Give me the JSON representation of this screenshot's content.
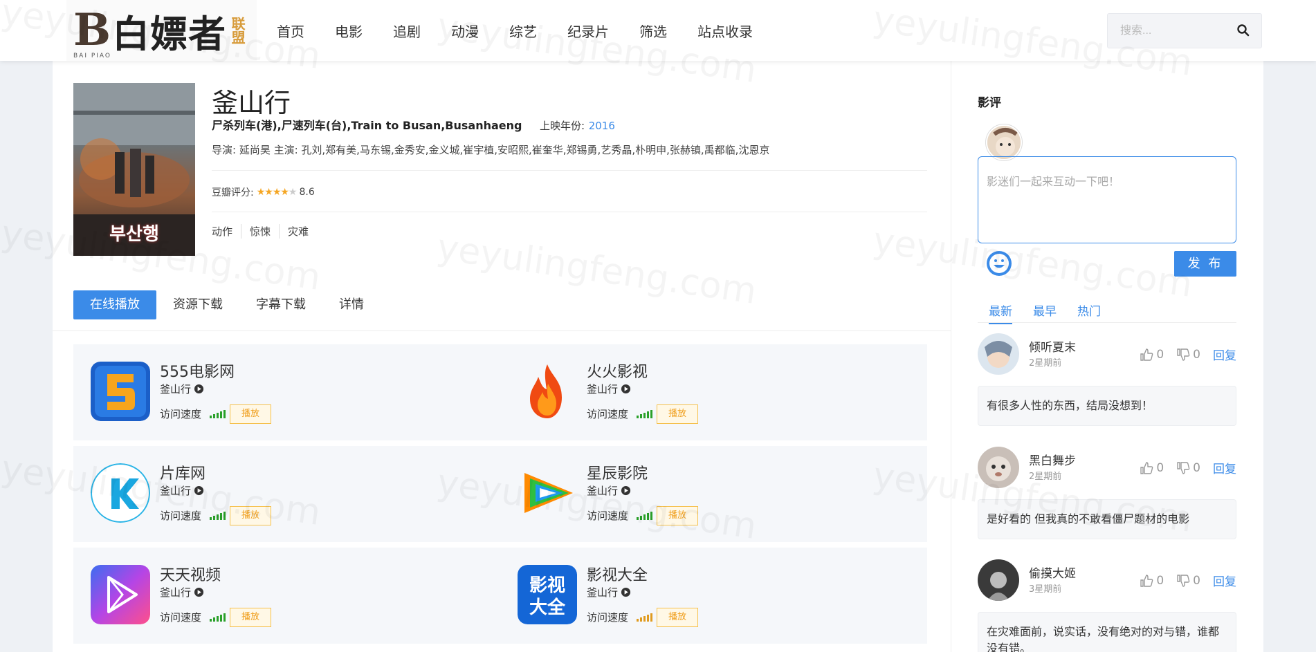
{
  "header": {
    "logo": {
      "mark": "B",
      "text": "白嫖者",
      "badge": "联盟",
      "sub": "BAI PIAO"
    },
    "nav": [
      "首页",
      "电影",
      "追剧",
      "动漫",
      "综艺",
      "纪录片",
      "筛选",
      "站点收录"
    ],
    "search_placeholder": "搜索..."
  },
  "watermark": "yeyulingfeng.com",
  "movie": {
    "title": "釜山行",
    "poster_text": "부산행",
    "aliases": "尸杀列车(港),尸速列车(台),Train to Busan,Busanhaeng",
    "year_label": "上映年份:",
    "year": "2016",
    "crew": "导演: 延尚昊    主演: 孔刘,郑有美,马东锡,金秀安,金义城,崔宇植,安昭熙,崔奎华,郑锡勇,艺秀晶,朴明申,张赫镇,禹都临,沈恩京",
    "rating_label": "豆瓣评分:",
    "rating": 8.6,
    "rating_text": "8.6",
    "tags": [
      "动作",
      "惊悚",
      "灾难"
    ]
  },
  "tabs": [
    "在线播放",
    "资源下载",
    "字幕下载",
    "详情"
  ],
  "sources": [
    {
      "name": "555电影网",
      "sub": "釜山行",
      "speed_label": "访问速度",
      "play": "播放",
      "icon": "555-icon",
      "bars": "green"
    },
    {
      "name": "火火影视",
      "sub": "釜山行",
      "speed_label": "访问速度",
      "play": "播放",
      "icon": "flame-icon",
      "bars": "green"
    },
    {
      "name": "片库网",
      "sub": "釜山行",
      "speed_label": "访问速度",
      "play": "播放",
      "icon": "k-icon",
      "bars": "green"
    },
    {
      "name": "星辰影院",
      "sub": "釜山行",
      "speed_label": "访问速度",
      "play": "播放",
      "icon": "rainbow-play-icon",
      "bars": "green"
    },
    {
      "name": "天天视频",
      "sub": "釜山行",
      "speed_label": "访问速度",
      "play": "播放",
      "icon": "tiantian-icon",
      "bars": "green"
    },
    {
      "name": "影视大全",
      "sub": "釜山行",
      "speed_label": "访问速度",
      "play": "播放",
      "icon": "yingshi-icon",
      "bars": "orange"
    }
  ],
  "sidebar": {
    "title": "影评",
    "placeholder": "影迷们一起来互动一下吧！",
    "publish": "发 布",
    "sort": [
      "最新",
      "最早",
      "热门"
    ],
    "comments": [
      {
        "user": "倾听夏末",
        "time": "2星期前",
        "likes": "0",
        "dislikes": "0",
        "reply": "回复",
        "text": "有很多人性的东西，结局没想到！"
      },
      {
        "user": "黑白舞步",
        "time": "2星期前",
        "likes": "0",
        "dislikes": "0",
        "reply": "回复",
        "text": "是好看的 但我真的不敢看僵尸题材的电影"
      },
      {
        "user": "偷摸大姬",
        "time": "3星期前",
        "likes": "0",
        "dislikes": "0",
        "reply": "回复",
        "text": "在灾难面前，说实话，没有绝对的对与错，谁都没有错。"
      }
    ]
  },
  "colors": {
    "accent": "#3b8be8",
    "play_border": "#f5c04b",
    "signal_green": "#2aa02a",
    "signal_orange": "#e09b1f"
  }
}
